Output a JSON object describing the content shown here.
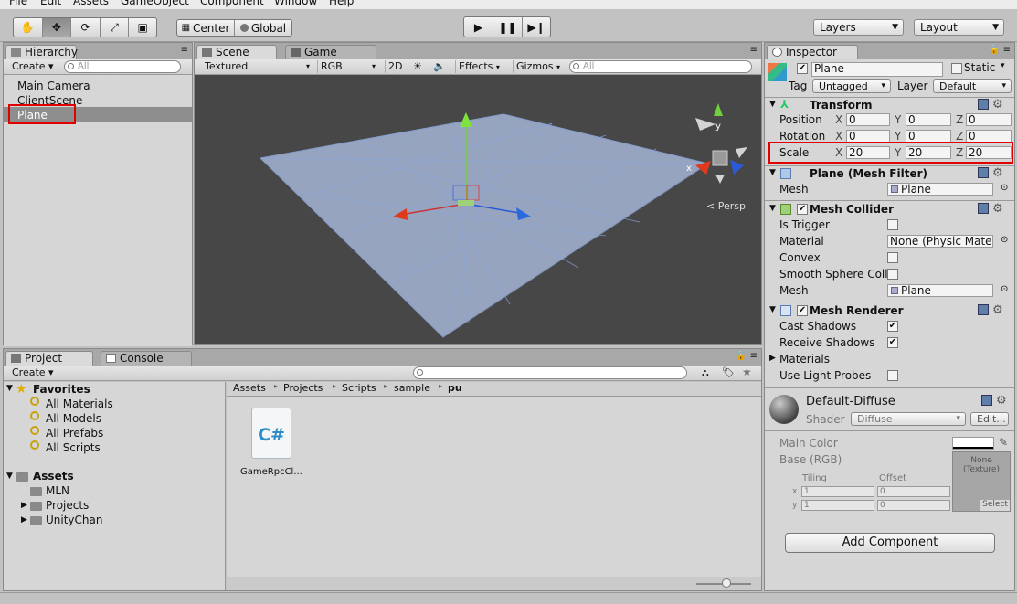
{
  "menu": [
    "File",
    "Edit",
    "Assets",
    "GameObject",
    "Component",
    "Window",
    "Help"
  ],
  "toolbar": {
    "pivot": "Center",
    "space": "Global",
    "layers": "Layers",
    "layout": "Layout"
  },
  "hierarchy": {
    "tab": "Hierarchy",
    "create": "Create",
    "search_placeholder": "All",
    "items": [
      "Main Camera",
      "ClientScene",
      "Plane"
    ],
    "selected": "Plane"
  },
  "scene": {
    "tab_scene": "Scene",
    "tab_game": "Game",
    "shading": "Textured",
    "render_mode": "RGB",
    "mode_2d": "2D",
    "effects": "Effects",
    "gizmos": "Gizmos",
    "search_placeholder": "All",
    "persp": "Persp",
    "gizmo_axes": {
      "x": "x",
      "y": "y"
    }
  },
  "project": {
    "tab_project": "Project",
    "tab_console": "Console",
    "create": "Create",
    "favorites_label": "Favorites",
    "favorites": [
      "All Materials",
      "All Models",
      "All Prefabs",
      "All Scripts"
    ],
    "assets_label": "Assets",
    "assets_children": [
      "MLN",
      "Projects",
      "UnityChan"
    ],
    "breadcrumb": [
      "Assets",
      "Projects",
      "Scripts",
      "sample",
      "pu"
    ],
    "file_name": "GameRpcCl...",
    "file_icon_text": "C#"
  },
  "inspector": {
    "tab": "Inspector",
    "object_name": "Plane",
    "static_label": "Static",
    "tag_label": "Tag",
    "tag_value": "Untagged",
    "layer_label": "Layer",
    "layer_value": "Default",
    "transform": {
      "title": "Transform",
      "position_label": "Position",
      "rotation_label": "Rotation",
      "scale_label": "Scale",
      "position": {
        "x": "0",
        "y": "0",
        "z": "0"
      },
      "rotation": {
        "x": "0",
        "y": "0",
        "z": "0"
      },
      "scale": {
        "x": "20",
        "y": "20",
        "z": "20"
      }
    },
    "mesh_filter": {
      "title": "Plane (Mesh Filter)",
      "mesh_label": "Mesh",
      "mesh_value": "Plane"
    },
    "mesh_collider": {
      "title": "Mesh Collider",
      "is_trigger": "Is Trigger",
      "material": "Material",
      "material_value": "None (Physic Materi",
      "convex": "Convex",
      "smooth": "Smooth Sphere Colli",
      "mesh_label": "Mesh",
      "mesh_value": "Plane"
    },
    "mesh_renderer": {
      "title": "Mesh Renderer",
      "cast_shadows": "Cast Shadows",
      "receive_shadows": "Receive Shadows",
      "materials": "Materials",
      "light_probes": "Use Light Probes"
    },
    "material": {
      "name": "Default-Diffuse",
      "shader_label": "Shader",
      "shader_value": "Diffuse",
      "edit": "Edit...",
      "main_color": "Main Color",
      "base": "Base (RGB)",
      "tiling": "Tiling",
      "offset": "Offset",
      "tiling_x": "1",
      "tiling_y": "1",
      "offset_x": "0",
      "offset_y": "0",
      "axis_x": "x",
      "axis_y": "y",
      "texture_none": "None\n(Texture)",
      "select": "Select"
    },
    "add_component": "Add Component"
  },
  "axis_letters": {
    "x": "X",
    "y": "Y",
    "z": "Z"
  }
}
